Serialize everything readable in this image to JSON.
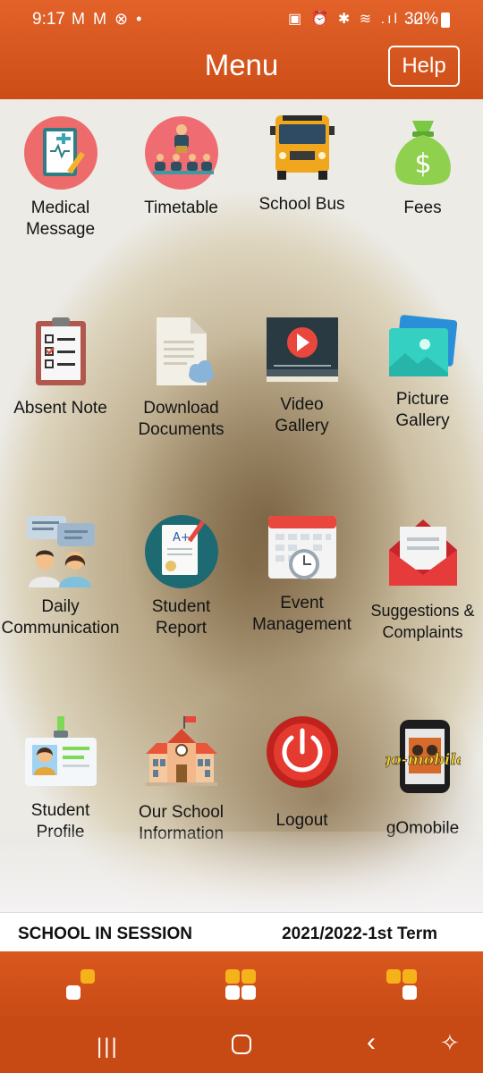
{
  "status_bar": {
    "time": "9:17",
    "left_icons": "M M ⊗ •",
    "right_icons": "▣ ⏰ ✱ ≋ .ıl .ıl",
    "battery": "32%"
  },
  "header": {
    "title": "Menu",
    "help_label": "Help"
  },
  "menu": {
    "items": [
      {
        "label_1": "Medical",
        "label_2": "Message",
        "icon": "medical-clipboard-icon"
      },
      {
        "label_1": "Timetable",
        "label_2": "",
        "icon": "classroom-teacher-icon"
      },
      {
        "label_1": "School Bus",
        "label_2": "",
        "icon": "school-bus-icon"
      },
      {
        "label_1": "Fees",
        "label_2": "",
        "icon": "money-bag-icon"
      },
      {
        "label_1": "Absent Note",
        "label_2": "",
        "icon": "checklist-clipboard-icon"
      },
      {
        "label_1": "Download",
        "label_2": "Documents",
        "icon": "document-cloud-icon"
      },
      {
        "label_1": "Video",
        "label_2": "Gallery",
        "icon": "video-player-icon"
      },
      {
        "label_1": "Picture",
        "label_2": "Gallery",
        "icon": "photo-stack-icon"
      },
      {
        "label_1": "Daily",
        "label_2": "Communication",
        "icon": "people-chat-icon"
      },
      {
        "label_1": "Student",
        "label_2": "Report",
        "icon": "report-card-icon"
      },
      {
        "label_1": "Event",
        "label_2": "Management",
        "icon": "calendar-clock-icon"
      },
      {
        "label_1": "Suggestions &",
        "label_2": "Complaints",
        "icon": "envelope-letter-icon"
      },
      {
        "label_1": "Student",
        "label_2": "Profile",
        "icon": "id-badge-icon"
      },
      {
        "label_1": "Our School",
        "label_2": "Information",
        "icon": "school-building-icon"
      },
      {
        "label_1": "Logout",
        "label_2": "",
        "icon": "power-icon"
      },
      {
        "label_1": "gOmobile",
        "label_2": "",
        "icon": "gomobile-phone-icon"
      }
    ]
  },
  "session": {
    "status": "SCHOOL IN SESSION",
    "term": "2021/2022-1st Term"
  },
  "colors": {
    "brand": "#d2541b",
    "accent_yellow": "#f6b21a"
  },
  "system_nav": {
    "recents": "|||",
    "back": "‹",
    "accessibility": "✧"
  }
}
